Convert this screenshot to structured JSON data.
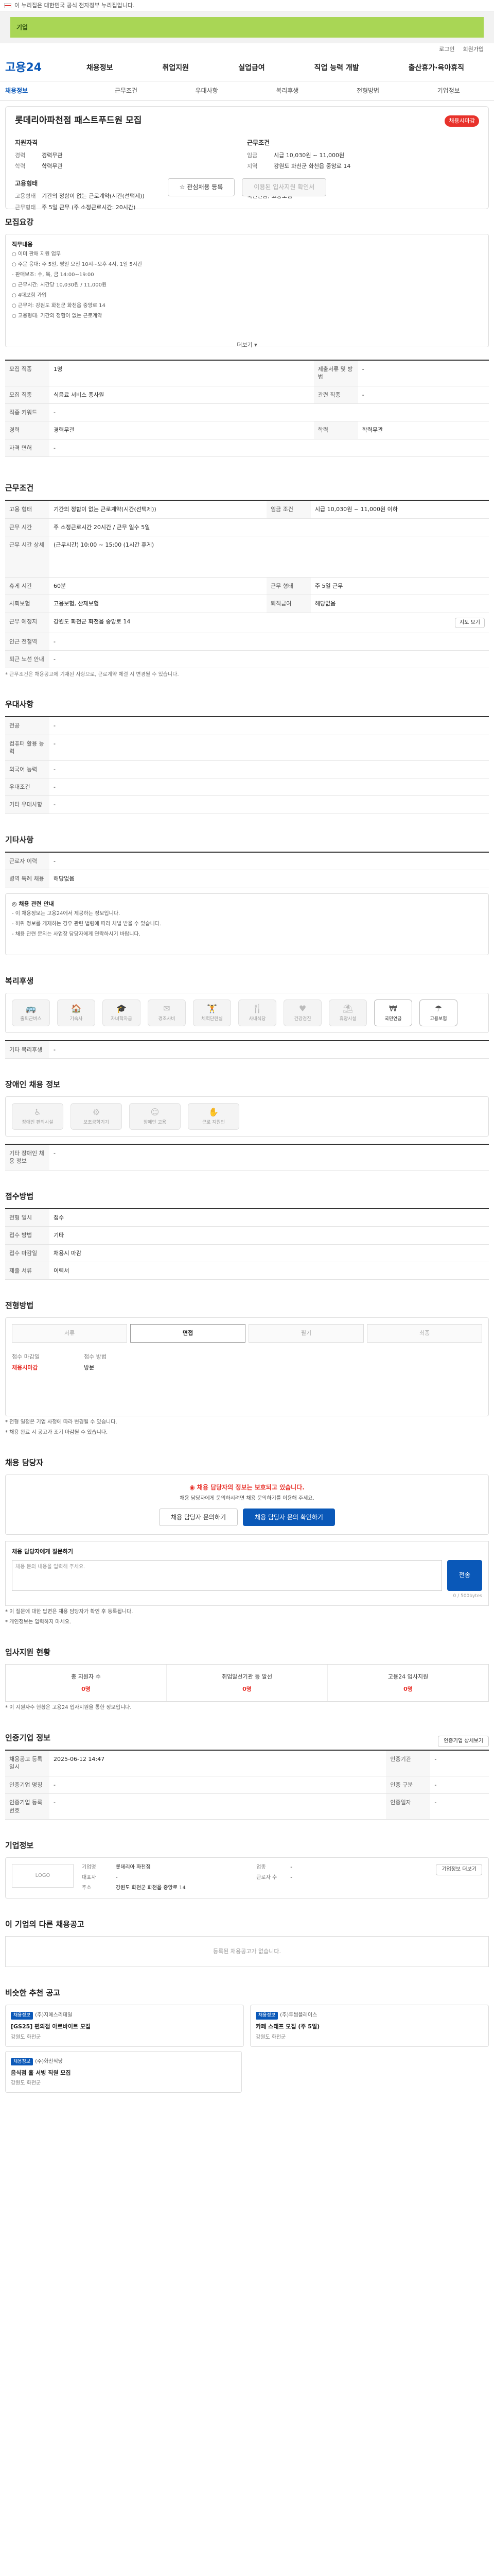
{
  "topbar": {
    "text": "이 누리집은 대한민국 공식 전자정부 누리집입니다."
  },
  "ad": {
    "text": "기업"
  },
  "util": [
    "로그인",
    "회원가입"
  ],
  "gnb": {
    "logo": "고용24",
    "menu": [
      "채용정보",
      "취업지원",
      "실업급여",
      "직업 능력 개발",
      "출산휴가·육아휴직"
    ]
  },
  "tabs": [
    "채용정보",
    "근무조건",
    "우대사항",
    "복리후생",
    "전형방법",
    "기업정보"
  ],
  "job": {
    "title": "롯데리아파천점 패스트푸드원 모집",
    "badge": "채용시마감",
    "company_head": "지원자격",
    "condition_head": "근무조건",
    "company_kv": [
      {
        "k": "경력",
        "v": "경력무관"
      },
      {
        "k": "학력",
        "v": "학력무관"
      }
    ],
    "condition_kv": [
      {
        "k": "임금",
        "v": "시급 10,030원 ~ 11,000원"
      },
      {
        "k": "지역",
        "v": "강원도 화천군 화천읍 중앙로 14"
      }
    ],
    "extra_head1": "고용형태",
    "extra_kv1": [
      {
        "k": "고용형태",
        "v": "기간의 정함이 없는 근로계약(시간(선택제))"
      },
      {
        "k": "근무형태",
        "v": "주 5일 근무 (주 소정근로시간: 20시간)"
      }
    ],
    "extra_head2": "복리후생",
    "extra_kv2": [
      {
        "k": "",
        "v": "국민연금, 고용보험"
      }
    ],
    "btn_apply": "관심채용 등록",
    "btn_disabled": "이용된 입사지원 확인서"
  },
  "recruit": {
    "heading": "모집요강",
    "lines": [
      "직무내용",
      "○ 이미 판매 지원 업무",
      "○ 주문 응대: 주 5일, 평일 오전 10시~오후 4시, 1일 5시간",
      "- 판매보조: 수, 목, 금 14:00~19:00",
      "○ 근무시간: 시간당 10,030원 / 11,000원",
      "○ 4대보험 가입",
      "○ 근무처: 강원도 화천군 화천읍 중앙로 14",
      "○ 고용형태: 기간의 정함이 없는 근로계약"
    ],
    "more": "더보기 ▾"
  },
  "recruit_tbl": [
    [
      "모집 직종",
      "1명",
      "제출서류 및 방법",
      "-"
    ],
    [
      "모집 직종",
      "식음료 서비스 종사원",
      "관련 직종",
      "-"
    ],
    [
      "직종 키워드",
      "-",
      "",
      ""
    ],
    [
      "경력",
      "경력무관",
      "학력",
      "학력무관"
    ],
    [
      "자격 면허",
      "-",
      "",
      ""
    ]
  ],
  "cond": {
    "heading": "근무조건",
    "tbl": [
      [
        "고용 형태",
        "기간의 정함이 없는 근로계약(시간(선택제))",
        "임금 조건",
        "시급 10,030원 ~ 11,000원 이하"
      ],
      [
        "근무 시간",
        "주 소정근로시간 20시간 / 근무 일수 5일",
        "",
        ""
      ],
      [
        "근무 시간 상세",
        "(근무시간) 10:00 ~ 15:00 (1시간 휴게)",
        "",
        ""
      ],
      [
        "휴게 시간",
        "60분",
        "근무 형태",
        "주 5일 근무"
      ],
      [
        "사회보험",
        "고용보험, 산재보험",
        "퇴직급여",
        "해당없음"
      ],
      [
        "근무 예정지",
        "강원도 화천군 화천읍 중앙로 14",
        "",
        ""
      ],
      [
        "인근 전철역",
        "-",
        "",
        ""
      ],
      [
        "퇴근 노선 안내",
        "-",
        "",
        ""
      ]
    ],
    "map_btn": "지도 보기",
    "note": "* 근무조건은 채용공고에 기재된 사항으로, 근로계약 체결 시 변경될 수 있습니다."
  },
  "pref": {
    "heading": "우대사항",
    "tbl": [
      [
        "전공",
        "-"
      ],
      [
        "컴퓨터 활용 능력",
        "-"
      ],
      [
        "외국어 능력",
        "-"
      ],
      [
        "우대조건",
        "-"
      ],
      [
        "기타 우대사항",
        "-"
      ]
    ]
  },
  "etc": {
    "heading": "기타사항",
    "tbl": [
      [
        "근로자 이력",
        "-"
      ],
      [
        "병역 특례 채용",
        "해당없음"
      ]
    ],
    "notice_title": "◎ 채용 관련 안내",
    "notices": [
      "- 이 채용정보는 고용24에서 제공하는 정보입니다.",
      "- 허위 정보를 게재하는 경우 관련 법령에 따라 처벌 받을 수 있습니다.",
      "- 채용 관련 문의는 사업장 담당자에게 연락하시기 바랍니다."
    ]
  },
  "welfare": {
    "heading": "복리후생",
    "items": [
      "출퇴근버스",
      "기숙사",
      "자녀학자금",
      "경조사비",
      "체력단련실",
      "사내식당",
      "건강검진",
      "휴양시설",
      "국민연금",
      "고용보험"
    ],
    "active": [
      8,
      9
    ],
    "other_label": "기타 복리후생",
    "other_value": "-"
  },
  "disability": {
    "heading": "장애인 채용 정보",
    "items": [
      "장애인 편의시설",
      "보조공학기기",
      "장애인 고용",
      "근로 지원인"
    ],
    "tbl_label": "기타 장애인 채용 정보",
    "tbl_value": "-"
  },
  "apply": {
    "heading": "접수방법",
    "tbl": [
      [
        "전형 일시",
        "접수"
      ],
      [
        "접수 방법",
        "기타"
      ],
      [
        "접수 마감일",
        "채용시 마감"
      ],
      [
        "제출 서류",
        "이력서"
      ]
    ]
  },
  "process": {
    "heading": "전형방법",
    "steps": [
      "서류",
      "면접",
      "필기",
      "최종"
    ],
    "active": 1,
    "info": [
      {
        "k": "접수 마감일",
        "v": "채용시마감"
      },
      {
        "k": "접수 방법",
        "v": "방문"
      }
    ],
    "bullets": [
      "* 전형 일정은 기업 사정에 따라 변경될 수 있습니다.",
      "* 채용 완료 시 공고가 조기 마감될 수 있습니다."
    ]
  },
  "manager": {
    "heading": "채용 담당자",
    "alert_title": "◉ 채용 담당자의 정보는 보호되고 있습니다.",
    "alert_desc": "채용 담당자에게 문의하시려면 채용 문의하기를 이용해 주세요.",
    "btn_a": "채용 담당자 문의하기",
    "btn_b": "채용 담당자 문의 확인하기",
    "inq_title": "채용 담당자에게 질문하기",
    "inq_placeholder": "채용 문의 내용을 입력해 주세요.",
    "inq_btn": "전송",
    "counter": "0 / 500bytes",
    "inq_notes": [
      "* 이 질문에 대한 답변은 채용 담당자가 확인 후 등록됩니다.",
      "* 개인정보는 입력하지 마세요."
    ]
  },
  "stats": {
    "heading": "입사지원 현황",
    "items": [
      {
        "l": "총 지원자 수",
        "n": "0명"
      },
      {
        "l": "취업알선기관 등 알선",
        "n": "0명"
      },
      {
        "l": "고용24 입사지원",
        "n": "0명"
      }
    ],
    "note": "* 이 지원자수 현황은 고용24 입사지원을 통한 정보입니다."
  },
  "info": {
    "heading": "인증기업 정보",
    "tbl": [
      [
        "채용공고 등록일시",
        "2025-06-12 14:47",
        "인증기관",
        "-"
      ],
      [
        "인증기업 명칭",
        "-",
        "인증 구분",
        "-"
      ],
      [
        "인증기업 등록번호",
        "-",
        "인증일자",
        "-"
      ]
    ],
    "btn": "인증기업 상세보기"
  },
  "corp": {
    "heading": "기업정보",
    "logo": "LOGO",
    "grid": [
      [
        "기업명",
        "롯데리아 화천점",
        "업종",
        "-"
      ],
      [
        "대표자",
        "-",
        "근로자 수",
        "-"
      ],
      [
        "주소",
        "강원도 화천군 화천읍 중앙로 14",
        "",
        ""
      ]
    ],
    "btn": "기업정보 더보기"
  },
  "others": {
    "heading": "이 기업의 다른 채용공고",
    "empty": "등록된 채용공고가 없습니다."
  },
  "recommend": {
    "heading": "비슷한 추천 공고",
    "cards": [
      {
        "tag": "채용정보",
        "name": "(주)지에스리테일",
        "title": "[GS25] 편의점 아르바이트 모집",
        "loc": "강원도 화천군"
      },
      {
        "tag": "채용정보",
        "name": "(주)투썸플레이스",
        "title": "카페 스태프 모집 (주 5일)",
        "loc": "강원도 화천군"
      },
      {
        "tag": "채용정보",
        "name": "(주)화천식당",
        "title": "음식점 홀 서빙 직원 모집",
        "loc": "강원도 화천군"
      }
    ]
  }
}
